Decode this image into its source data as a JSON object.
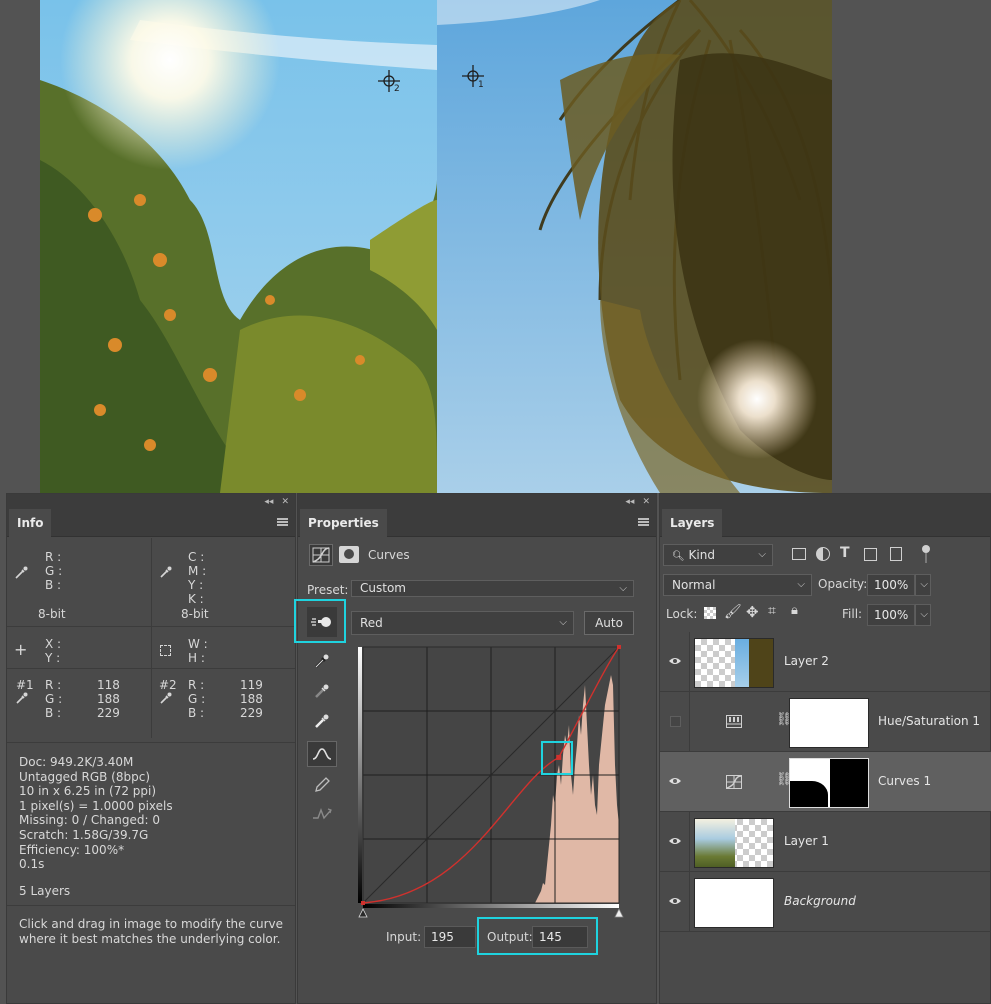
{
  "info": {
    "tab": "Info",
    "rgb_labels": [
      "R :",
      "G :",
      "B :"
    ],
    "cmyk_labels": [
      "C :",
      "M :",
      "Y :",
      "K :"
    ],
    "bit_left": "8-bit",
    "bit_right": "8-bit",
    "xy_labels": [
      "X :",
      "Y :"
    ],
    "wh_labels": [
      "W :",
      "H :"
    ],
    "sample1": {
      "id": "#1",
      "labels": [
        "R :",
        "G :",
        "B :"
      ],
      "values": [
        "118",
        "188",
        "229"
      ]
    },
    "sample2": {
      "id": "#2",
      "labels": [
        "R :",
        "G :",
        "B :"
      ],
      "values": [
        "119",
        "188",
        "229"
      ]
    },
    "doc_lines": [
      "Doc: 949.2K/3.40M",
      "Untagged RGB (8bpc)",
      "10 in x 6.25 in (72 ppi)",
      "1 pixel(s) = 1.0000 pixels",
      "Missing: 0 / Changed: 0",
      "Scratch: 1.58G/39.7G",
      "Efficiency: 100%*",
      "0.1s"
    ],
    "layers_count": "5 Layers",
    "hint": "Click and drag in image to modify the curve\nwhere it best matches the underlying color."
  },
  "properties": {
    "tab": "Properties",
    "title": "Curves",
    "preset_label": "Preset:",
    "preset_value": "Custom",
    "channel_value": "Red",
    "auto_label": "Auto",
    "input_label": "Input:",
    "input_value": "195",
    "output_label": "Output:",
    "output_value": "145"
  },
  "curve": {
    "input": 195,
    "output": 145
  },
  "layers": {
    "tab": "Layers",
    "filter_value": "Kind",
    "blend_mode": "Normal",
    "opacity_label": "Opacity:",
    "opacity_value": "100%",
    "lock_label": "Lock:",
    "fill_label": "Fill:",
    "fill_value": "100%",
    "items": [
      {
        "name": "Layer 2"
      },
      {
        "name": "Hue/Saturation 1"
      },
      {
        "name": "Curves 1"
      },
      {
        "name": "Layer 1"
      },
      {
        "name": "Background"
      }
    ]
  },
  "canvas_markers": {
    "marker1": "1",
    "marker2": "2"
  },
  "colors": {
    "highlight": "#1fd3df",
    "panel_bg": "#4a4a4a",
    "curve_red": "#d0312d"
  }
}
